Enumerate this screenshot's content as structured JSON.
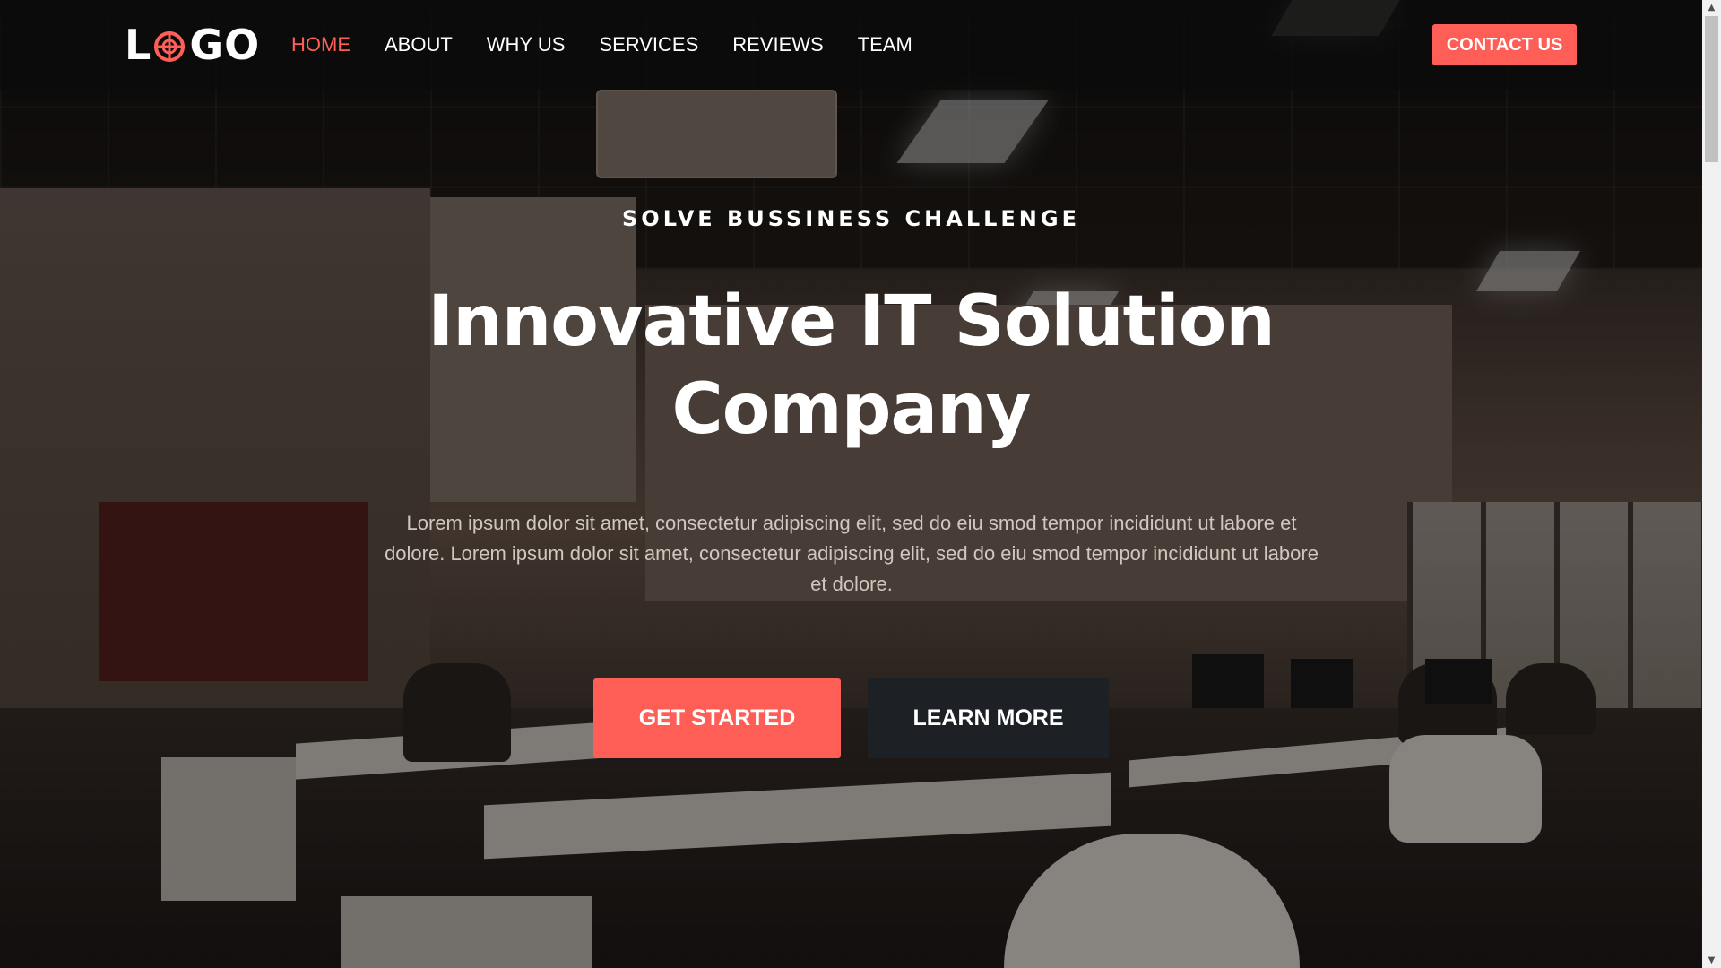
{
  "brand": {
    "logo_prefix": "L",
    "logo_suffix": "GO",
    "accent_color": "#ff5e57",
    "dark_button_color": "#1d2126"
  },
  "nav": {
    "items": [
      {
        "label": "HOME",
        "active": true
      },
      {
        "label": "ABOUT",
        "active": false
      },
      {
        "label": "WHY US",
        "active": false
      },
      {
        "label": "SERVICES",
        "active": false
      },
      {
        "label": "REVIEWS",
        "active": false
      },
      {
        "label": "TEAM",
        "active": false
      }
    ],
    "contact_label": "CONTACT US"
  },
  "hero": {
    "eyebrow": "SOLVE BUSSINESS CHALLENGE",
    "title_line1": "Innovative IT Solution",
    "title_line2": "Company",
    "description": "Lorem ipsum dolor sit amet, consectetur adipiscing elit, sed do eiu smod tempor incididunt ut labore et dolore. Lorem ipsum dolor sit amet, consectetur adipiscing elit, sed do eiu smod tempor incididunt ut labore et dolore.",
    "primary_button": "GET STARTED",
    "secondary_button": "LEARN MORE",
    "background_icon": "office-photo"
  },
  "scrollbar": {
    "up_icon": "arrow-up-icon",
    "down_icon": "arrow-down-icon"
  }
}
